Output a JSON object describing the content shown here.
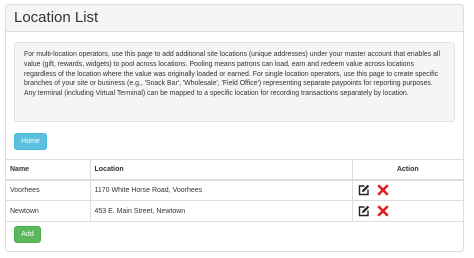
{
  "page": {
    "title": "Location List",
    "description": "For multi-location operators, use this page to add additional site locations (unique addresses) under your master account that enables all value (gift, rewards, widgets) to pool across locations. Pooling means patrons can load, earn and redeem value across locations regardless of the location where the value was originally loaded or earned. For single location operators, use this page to create specific branches of your site or business (e.g., 'Snack Bar', 'Wholesale', 'Field Office') representing separate paypoints for reporting purposes. Any terminal (including Virtual Terminal) can be mapped to a specific location for recording transactions separately by location."
  },
  "buttons": {
    "home": "Home",
    "add": "Add"
  },
  "table": {
    "headers": {
      "name": "Name",
      "location": "Location",
      "action": "Action"
    },
    "rows": [
      {
        "name": "Voorhees",
        "location": "1170 White Horse Road, Voorhees"
      },
      {
        "name": "Newtown",
        "location": "453 E. Main Street, Newtown"
      }
    ]
  },
  "icons": {
    "edit": "edit-icon",
    "delete": "delete-icon"
  },
  "colors": {
    "home_button": "#5bc0de",
    "add_button": "#5cb85c",
    "delete_icon": "#e02020",
    "heading_bg": "#f5f5f5"
  }
}
